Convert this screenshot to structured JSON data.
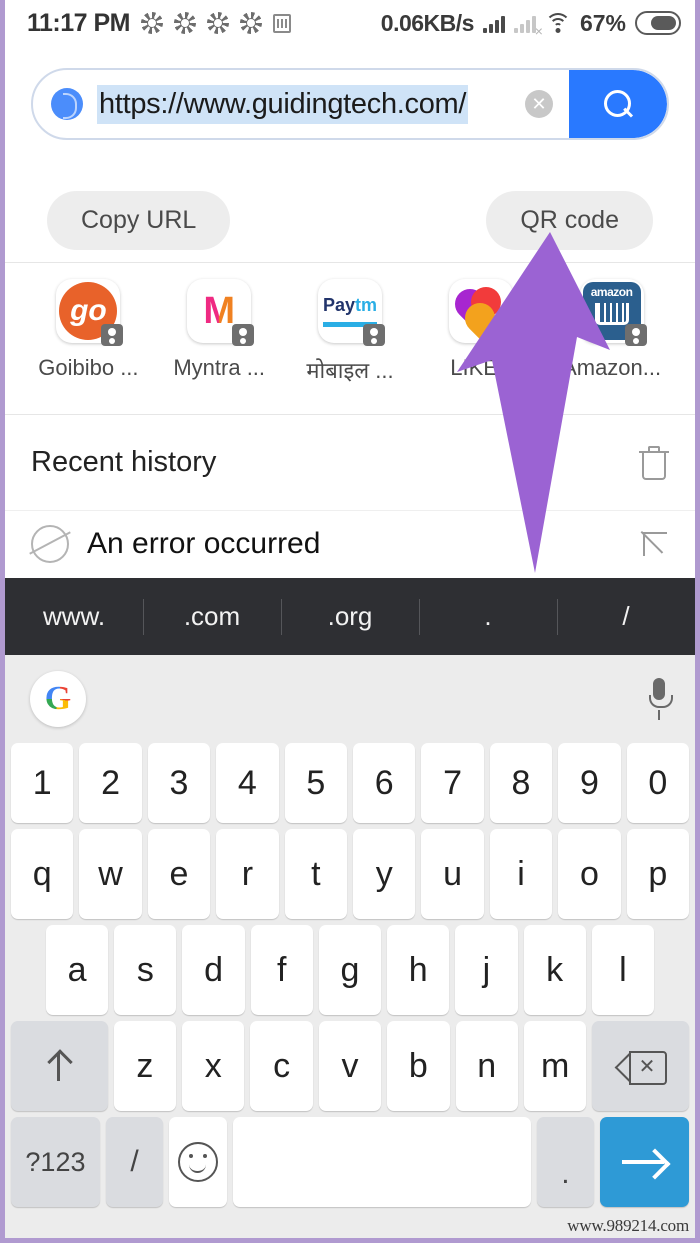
{
  "status_bar": {
    "time": "11:17 PM",
    "notification_icons": [
      "shutter-icon",
      "shutter-icon",
      "shutter-icon",
      "shutter-icon",
      "badge-icon"
    ],
    "network_speed": "0.06KB/s",
    "signal_icon": "signal-bars-icon",
    "signal_no_sim_icon": "signal-no-sim-icon",
    "wifi_icon": "wifi-icon",
    "battery_percent": "67%",
    "battery_icon": "battery-icon"
  },
  "urlbar": {
    "site_icon": "site-globe-icon",
    "url": "https://www.guidingtech.com/",
    "clear_icon": "clear-x-icon",
    "search_icon": "search-icon"
  },
  "actions": {
    "copy_url": "Copy URL",
    "qr_code": "QR code"
  },
  "shortcuts": [
    {
      "label": "Goibibo ...",
      "icon": "goibibo-icon"
    },
    {
      "label": "Myntra ...",
      "icon": "myntra-icon"
    },
    {
      "label": "मोबाइल ...",
      "icon": "paytm-icon"
    },
    {
      "label": "LIKE -",
      "icon": "like-icon"
    },
    {
      "label": "Amazon...",
      "icon": "amazon-icon"
    }
  ],
  "history": {
    "title": "Recent history",
    "clear_icon": "trash-icon",
    "item_text": "An error occurred",
    "item_icon": "globe-icon",
    "item_goto_icon": "arrow-up-left-icon"
  },
  "annotation": {
    "arrow_color": "#9b63d3",
    "arrow_icon": "pointer-arrow-annotation"
  },
  "suggestion_strip": [
    "www.",
    ".com",
    ".org",
    ".",
    "/"
  ],
  "keyboard": {
    "toolbar": {
      "google_letter": "G",
      "google_icon": "google-logo-icon",
      "mic_icon": "microphone-icon"
    },
    "row_numbers": [
      "1",
      "2",
      "3",
      "4",
      "5",
      "6",
      "7",
      "8",
      "9",
      "0"
    ],
    "row_top": [
      "q",
      "w",
      "e",
      "r",
      "t",
      "y",
      "u",
      "i",
      "o",
      "p"
    ],
    "row_home": [
      "a",
      "s",
      "d",
      "f",
      "g",
      "h",
      "j",
      "k",
      "l"
    ],
    "row_bottom": [
      "z",
      "x",
      "c",
      "v",
      "b",
      "n",
      "m"
    ],
    "shift_icon": "shift-arrow-icon",
    "backspace_icon": "backspace-icon",
    "symbols_label": "?123",
    "slash_label": "/",
    "emoji_icon": "emoji-smiley-icon",
    "space_label": "",
    "period_label": ".",
    "enter_icon": "enter-arrow-icon"
  },
  "watermark": "www.989214.com"
}
